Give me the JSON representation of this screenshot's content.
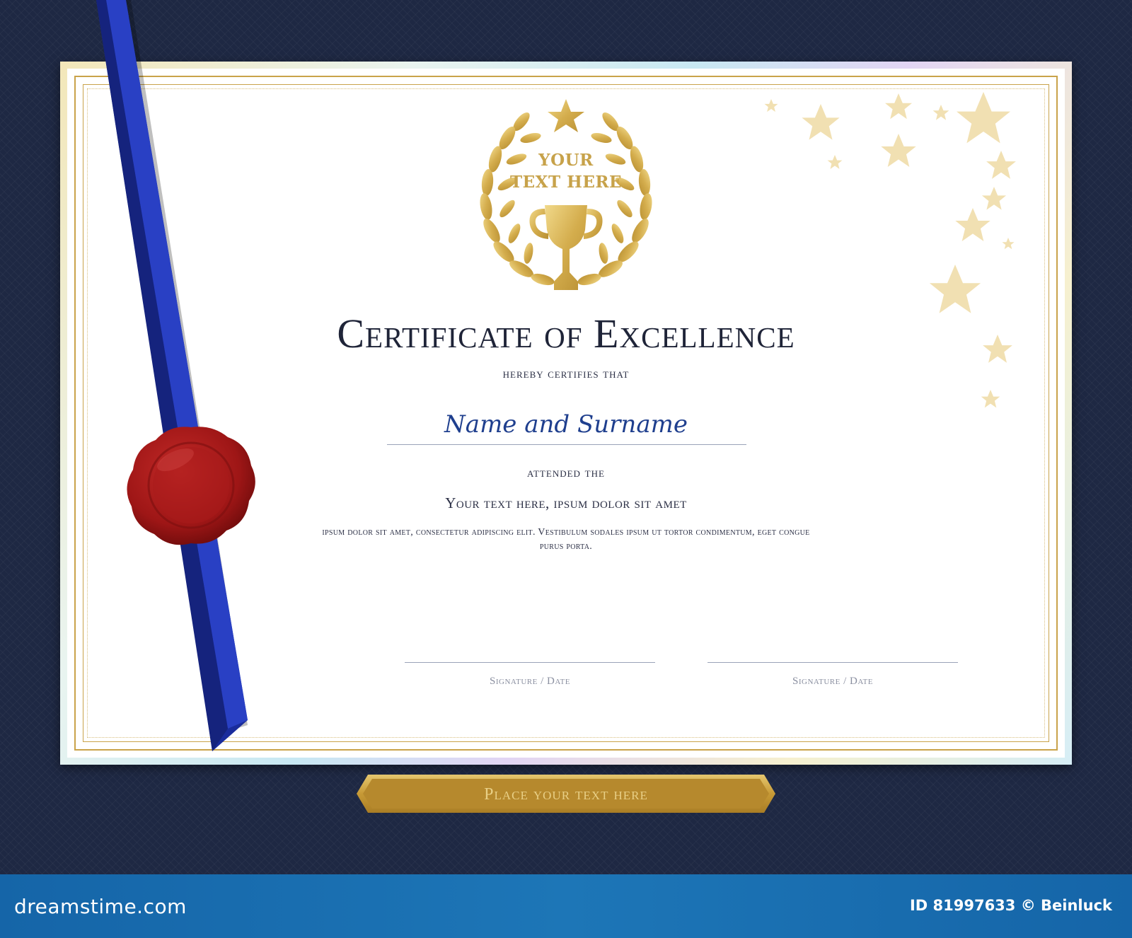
{
  "emblem": {
    "line1": "YOUR",
    "line2": "TEXT HERE",
    "icons": [
      "laurel-wreath-icon",
      "star-icon",
      "trophy-icon"
    ]
  },
  "certificate": {
    "title": "Certificate of Excellence",
    "subtitle": "hereby certifies that",
    "recipient": "Name and Surname",
    "attended": "attended the",
    "course": "Your text here, ipsum dolor sit amet",
    "description": "ipsum dolor sit amet, consectetur adipiscing elit. Vestibulum sodales ipsum ut tortor condimentum, eget congue purus porta."
  },
  "signatures": [
    {
      "label": "Signature / Date"
    },
    {
      "label": "Signature / Date"
    }
  ],
  "plate": {
    "text": "Place your text here"
  },
  "footer": {
    "logo": "dreamstime.com",
    "id": "ID 81997633 © Beinluck"
  },
  "colors": {
    "gold": "#c9a34a",
    "navy_background": "#1e2843",
    "ribbon_blue": "#1b2fa0",
    "wax_red": "#b21f1f",
    "footer_blue": "#1d76b7"
  }
}
